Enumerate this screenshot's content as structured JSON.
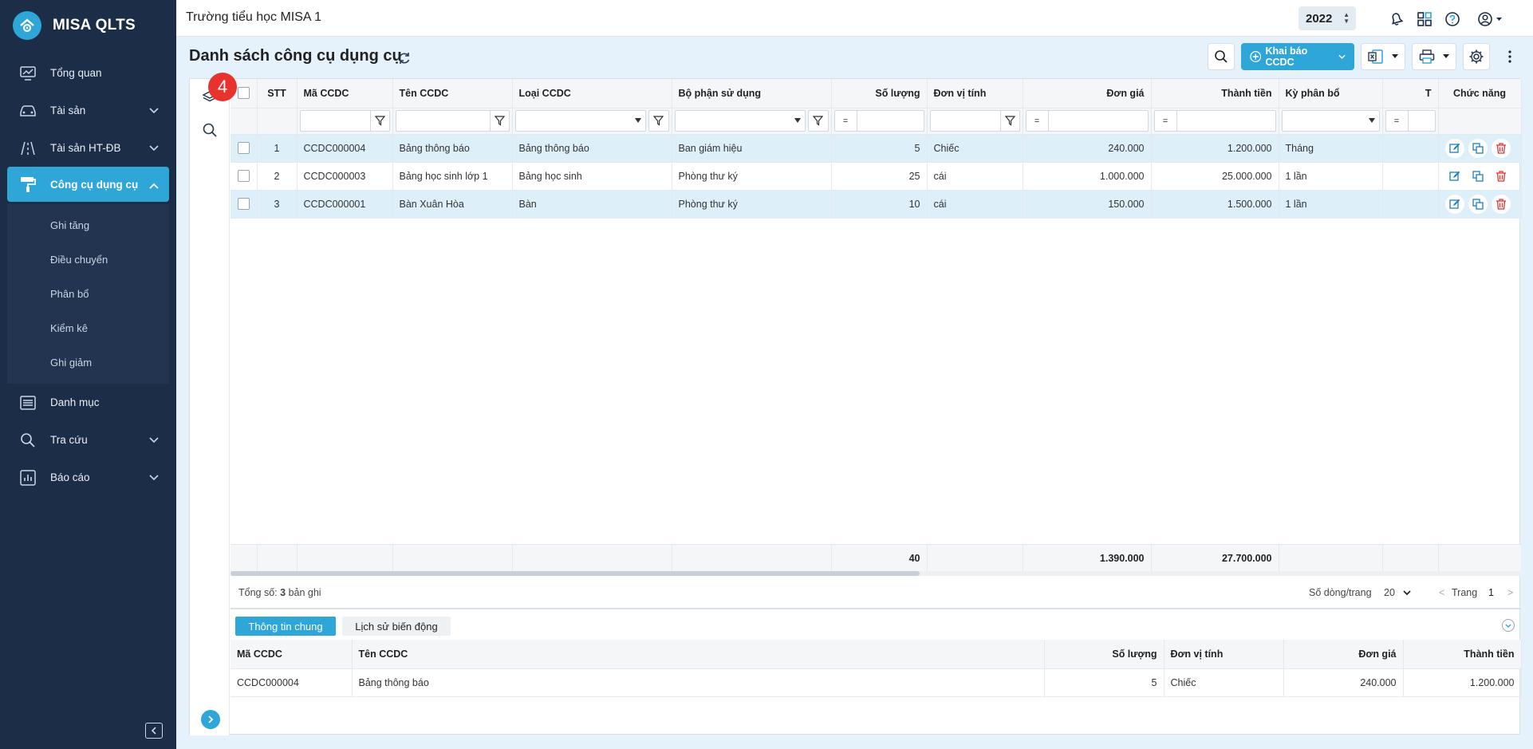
{
  "app": {
    "name": "MISA QLTS"
  },
  "sidebar": {
    "items": [
      {
        "label": "Tổng quan"
      },
      {
        "label": "Tài sản"
      },
      {
        "label": "Tài sản HT-ĐB"
      },
      {
        "label": "Công cụ dụng cụ"
      },
      {
        "label": "Danh mục"
      },
      {
        "label": "Tra cứu"
      },
      {
        "label": "Báo cáo"
      }
    ],
    "subitems": [
      {
        "label": "Ghi tăng"
      },
      {
        "label": "Điều chuyển"
      },
      {
        "label": "Phân bổ"
      },
      {
        "label": "Kiểm kê"
      },
      {
        "label": "Ghi giảm"
      }
    ]
  },
  "topbar": {
    "org": "Trường tiểu học MISA 1",
    "year": "2022"
  },
  "page": {
    "title": "Danh sách công cụ dụng cụ",
    "add_button": "Khai báo CCDC",
    "badge": "4"
  },
  "grid": {
    "columns": {
      "stt": "STT",
      "ma": "Mã CCDC",
      "ten": "Tên CCDC",
      "loai": "Loại CCDC",
      "bophan": "Bộ phận sử dụng",
      "soluong": "Số lượng",
      "dvt": "Đơn vị tính",
      "dongia": "Đơn giá",
      "thanhtien": "Thành tiền",
      "kyphanbo": "Kỳ phân bổ",
      "t": "T",
      "chucnang": "Chức năng"
    },
    "filter_eq": "=",
    "rows": [
      {
        "stt": "1",
        "ma": "CCDC000004",
        "ten": "Bảng thông báo",
        "loai": "Bảng thông báo",
        "bophan": "Ban giám hiệu",
        "soluong": "5",
        "dvt": "Chiếc",
        "dongia": "240.000",
        "thanhtien": "1.200.000",
        "ky": "Tháng"
      },
      {
        "stt": "2",
        "ma": "CCDC000003",
        "ten": "Bảng học sinh lớp 1",
        "loai": "Bảng học sinh",
        "bophan": "Phòng thư ký",
        "soluong": "25",
        "dvt": "cái",
        "dongia": "1.000.000",
        "thanhtien": "25.000.000",
        "ky": "1 lần"
      },
      {
        "stt": "3",
        "ma": "CCDC000001",
        "ten": "Bàn Xuân Hòa",
        "loai": "Bàn",
        "bophan": "Phòng thư ký",
        "soluong": "10",
        "dvt": "cái",
        "dongia": "150.000",
        "thanhtien": "1.500.000",
        "ky": "1 lần"
      }
    ],
    "summary": {
      "soluong": "40",
      "dongia": "1.390.000",
      "thanhtien": "27.700.000"
    }
  },
  "pager": {
    "total_prefix": "Tổng số:",
    "total_count": "3",
    "total_suffix": "bản ghi",
    "rows_label": "Số dòng/trang",
    "rows_value": "20",
    "page_label": "Trang",
    "page_value": "1",
    "prev": "<",
    "next": ">"
  },
  "detail": {
    "tabs": [
      "Thông tin chung",
      "Lịch sử biến động"
    ],
    "columns": {
      "ma": "Mã CCDC",
      "ten": "Tên CCDC",
      "soluong": "Số lượng",
      "dvt": "Đơn vị tính",
      "dongia": "Đơn giá",
      "thanhtien": "Thành tiền"
    },
    "row": {
      "ma": "CCDC000004",
      "ten": "Bảng thông báo",
      "soluong": "5",
      "dvt": "Chiếc",
      "dongia": "240.000",
      "thanhtien": "1.200.000"
    }
  },
  "colors": {
    "accent": "#2ea6d8",
    "sidebar": "#1c2d47",
    "selected_row": "#ddeff8",
    "delete": "#e8322d",
    "badge": "#e8322d"
  }
}
